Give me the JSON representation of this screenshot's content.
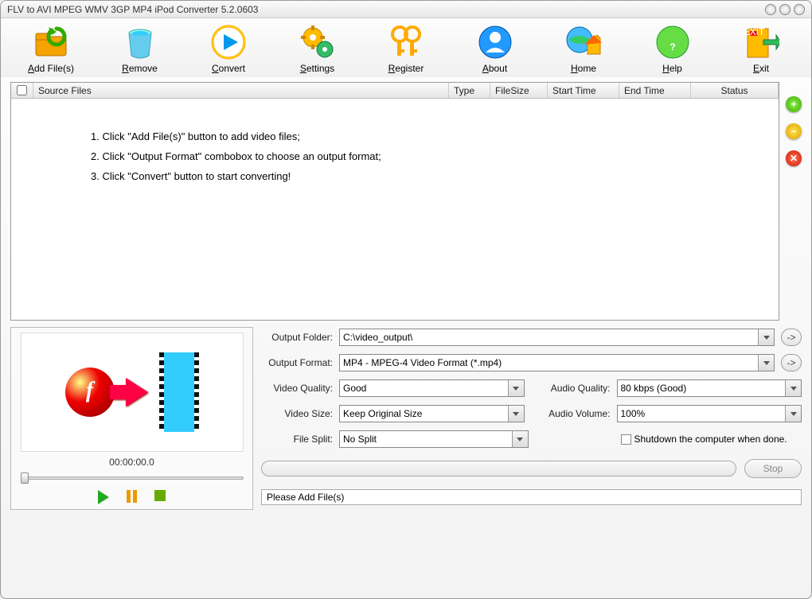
{
  "window": {
    "title": "FLV to AVI MPEG WMV 3GP MP4 iPod Converter 5.2.0603"
  },
  "toolbar": [
    {
      "label": "Add File(s)",
      "u": "A",
      "rest": "dd File(s)",
      "icon": "folder-add-icon"
    },
    {
      "label": "Remove",
      "u": "R",
      "rest": "emove",
      "icon": "trash-icon"
    },
    {
      "label": "Convert",
      "u": "C",
      "rest": "onvert",
      "icon": "play-icon"
    },
    {
      "label": "Settings",
      "u": "S",
      "rest": "ettings",
      "icon": "gear-icon"
    },
    {
      "label": "Register",
      "u": "R",
      "rest": "egister",
      "icon": "key-icon"
    },
    {
      "label": "About",
      "u": "A",
      "rest": "bout",
      "icon": "user-icon"
    },
    {
      "label": "Home",
      "u": "H",
      "rest": "ome",
      "icon": "home-icon"
    },
    {
      "label": "Help",
      "u": "H",
      "rest": "elp",
      "icon": "help-icon"
    },
    {
      "label": "Exit",
      "u": "E",
      "rest": "xit",
      "icon": "exit-icon"
    }
  ],
  "columns": {
    "source": "Source Files",
    "type": "Type",
    "size": "FileSize",
    "start": "Start Time",
    "end": "End Time",
    "status": "Status"
  },
  "hints": [
    "1. Click \"Add File(s)\" button to add video files;",
    "2. Click \"Output Format\" combobox to choose an output format;",
    "3. Click \"Convert\" button to start converting!"
  ],
  "preview": {
    "time": "00:00:00.0"
  },
  "settings": {
    "output_folder_label": "Output Folder:",
    "output_folder": "C:\\video_output\\",
    "output_format_label": "Output Format:",
    "output_format": "MP4 - MPEG-4 Video Format (*.mp4)",
    "video_quality_label": "Video Quality:",
    "video_quality": "Good",
    "audio_quality_label": "Audio Quality:",
    "audio_quality": "80  kbps (Good)",
    "video_size_label": "Video Size:",
    "video_size": "Keep Original Size",
    "audio_volume_label": "Audio Volume:",
    "audio_volume": "100%",
    "file_split_label": "File Split:",
    "file_split": "No Split",
    "shutdown_label": "Shutdown the computer when done."
  },
  "buttons": {
    "stop": "Stop",
    "browse": "->"
  },
  "status": "Please Add File(s)"
}
